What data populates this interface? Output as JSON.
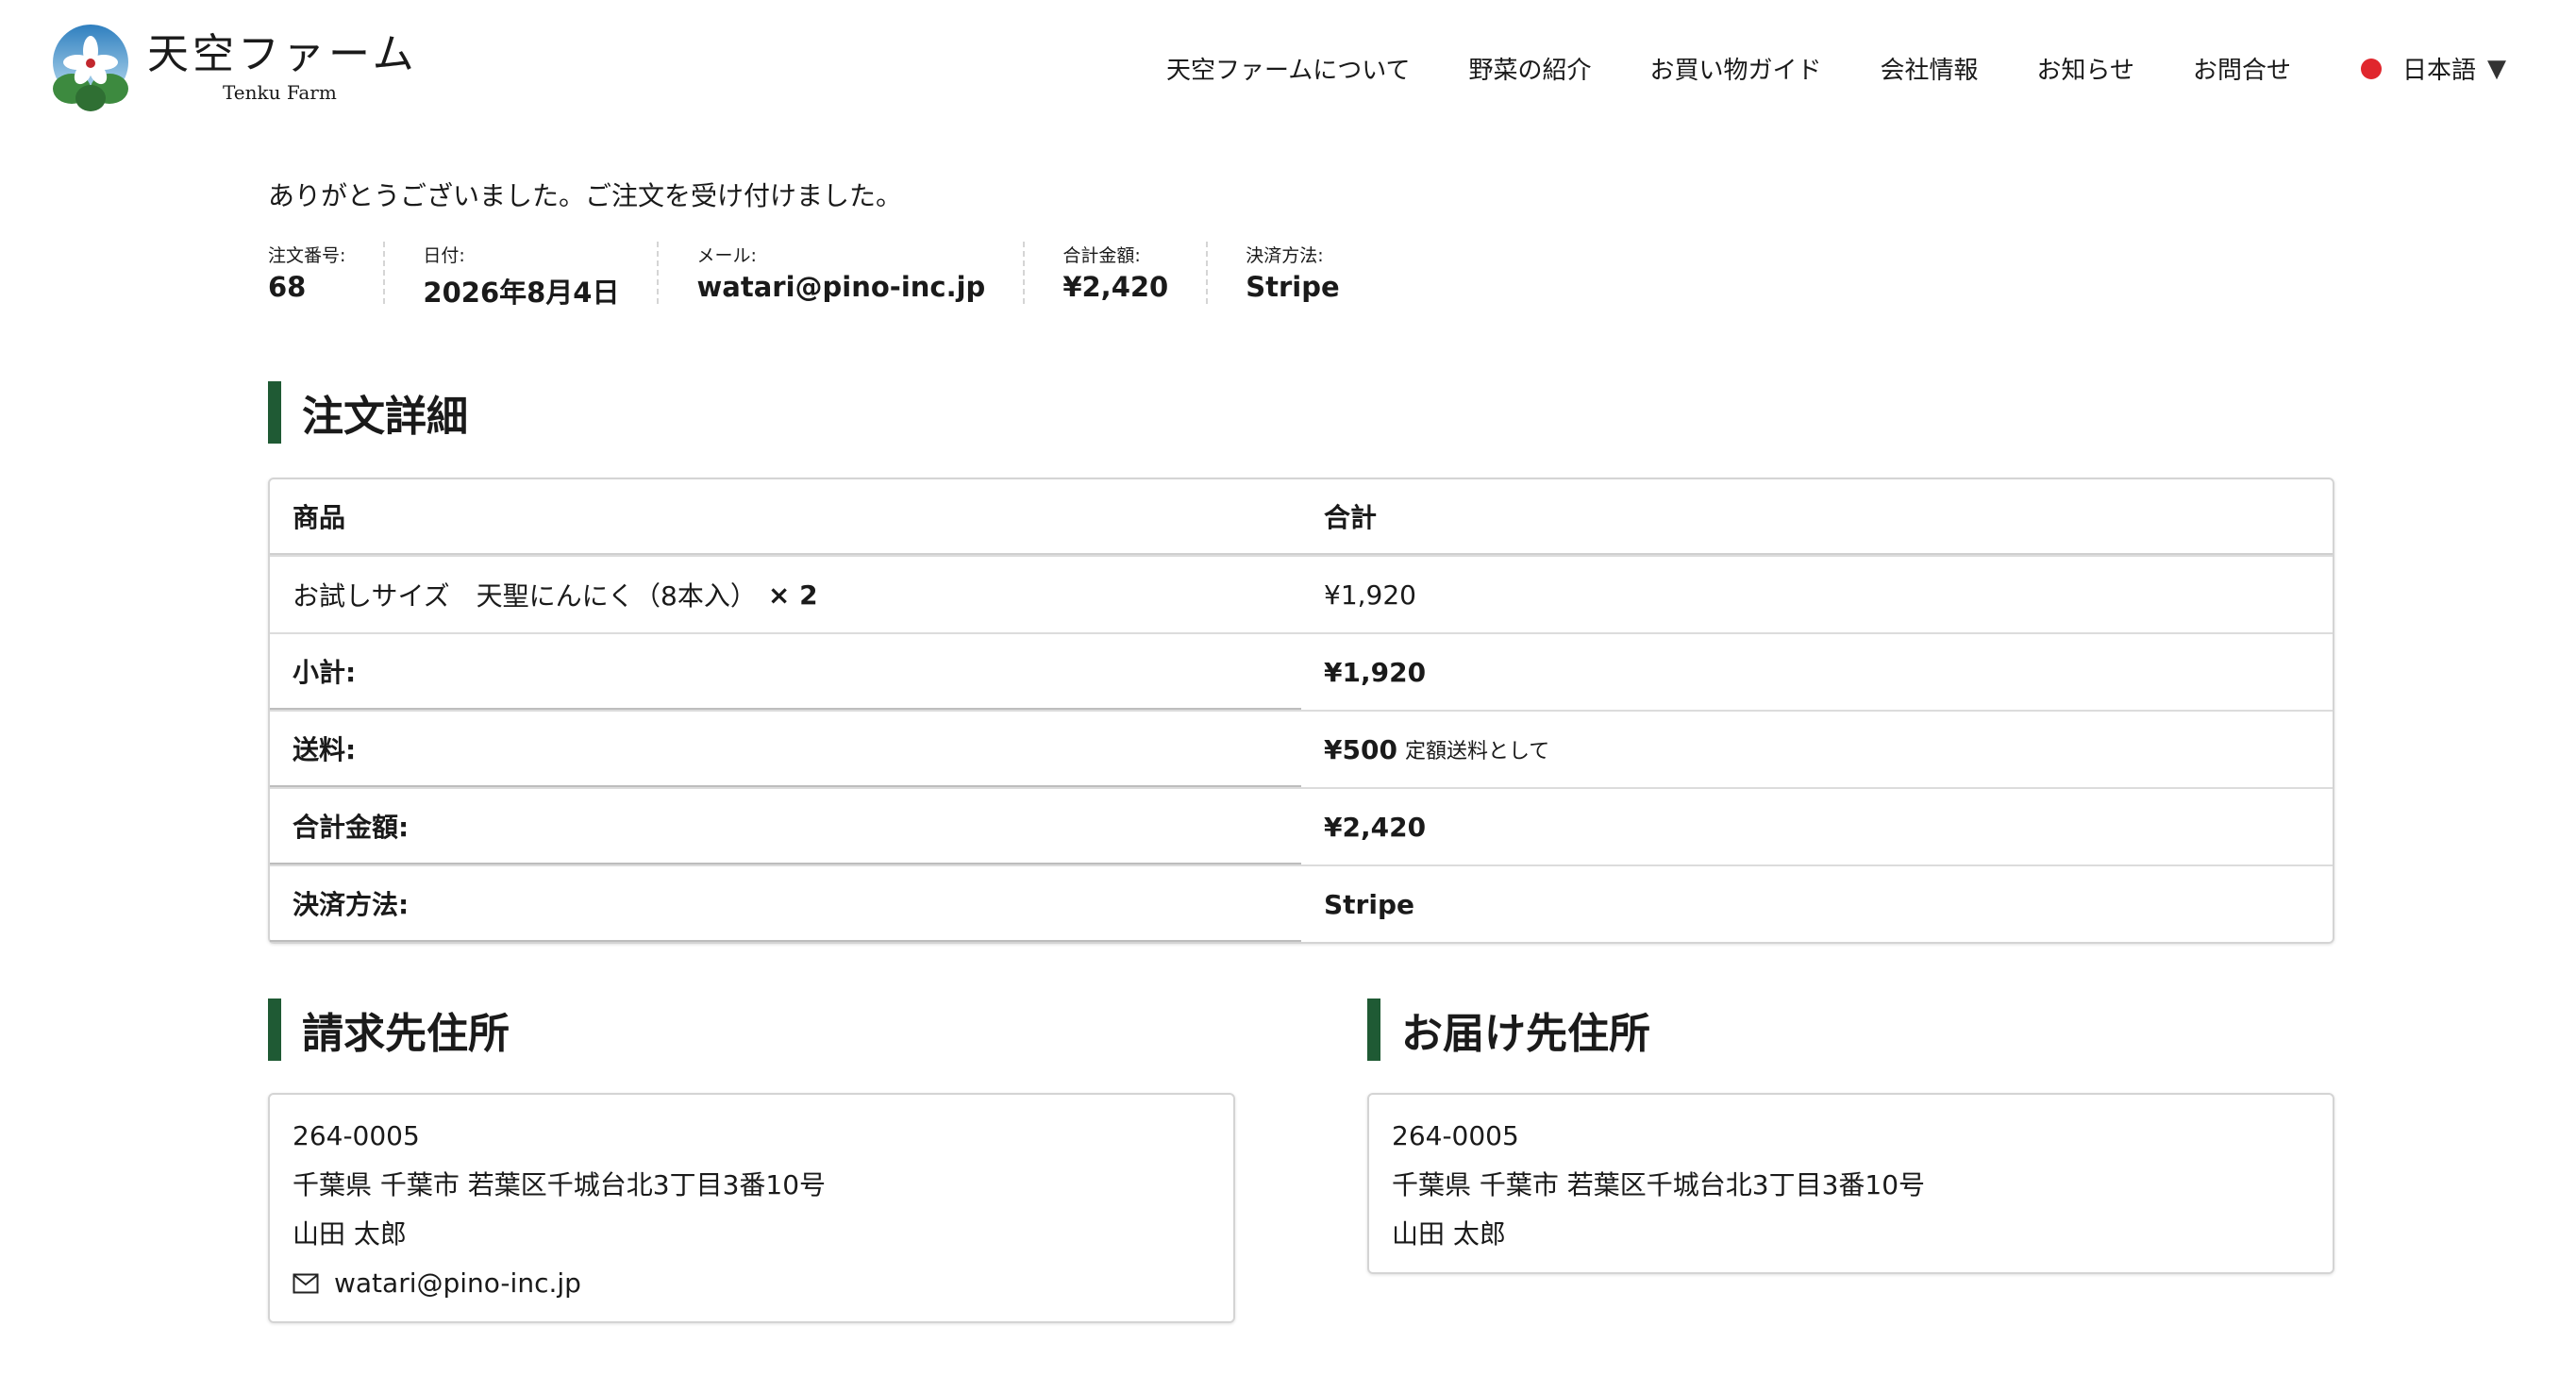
{
  "brand": {
    "name_jp": "天空ファーム",
    "name_en": "Tenku Farm"
  },
  "nav": {
    "items": [
      "天空ファームについて",
      "野菜の紹介",
      "お買い物ガイド",
      "会社情報",
      "お知らせ",
      "お問合せ"
    ],
    "language": "日本語",
    "language_arrow": "▼"
  },
  "order": {
    "thanks": "ありがとうございました。ご注文を受け付けました。",
    "overview": [
      {
        "label": "注文番号:",
        "value": "68"
      },
      {
        "label": "日付:",
        "value": "2026年8月4日"
      },
      {
        "label": "メール:",
        "value": "watari@pino-inc.jp"
      },
      {
        "label": "合計金額:",
        "value": "¥2,420"
      },
      {
        "label": "決済方法:",
        "value": "Stripe"
      }
    ]
  },
  "details": {
    "title": "注文詳細",
    "header": {
      "product": "商品",
      "total": "合計"
    },
    "item": {
      "name": "お試しサイズ　天聖にんにく（8本入）",
      "qty": "× 2",
      "price": "¥1,920"
    },
    "subtotal": {
      "label": "小計:",
      "value": "¥1,920"
    },
    "shipping": {
      "label": "送料:",
      "value": "¥500",
      "note": "定額送料として"
    },
    "total": {
      "label": "合計金額:",
      "value": "¥2,420"
    },
    "payment": {
      "label": "決済方法:",
      "value": "Stripe"
    }
  },
  "billing": {
    "title": "請求先住所",
    "postal": "264-0005",
    "address": "千葉県 千葉市 若葉区千城台北3丁目3番10号",
    "name": "山田 太郎",
    "email": "watari@pino-inc.jp"
  },
  "shipping_address": {
    "title": "お届け先住所",
    "postal": "264-0005",
    "address": "千葉県 千葉市 若葉区千城台北3丁目3番10号",
    "name": "山田 太郎"
  },
  "colors": {
    "accent_green": "#1f5a34",
    "lang_dot": "#e0262d"
  }
}
